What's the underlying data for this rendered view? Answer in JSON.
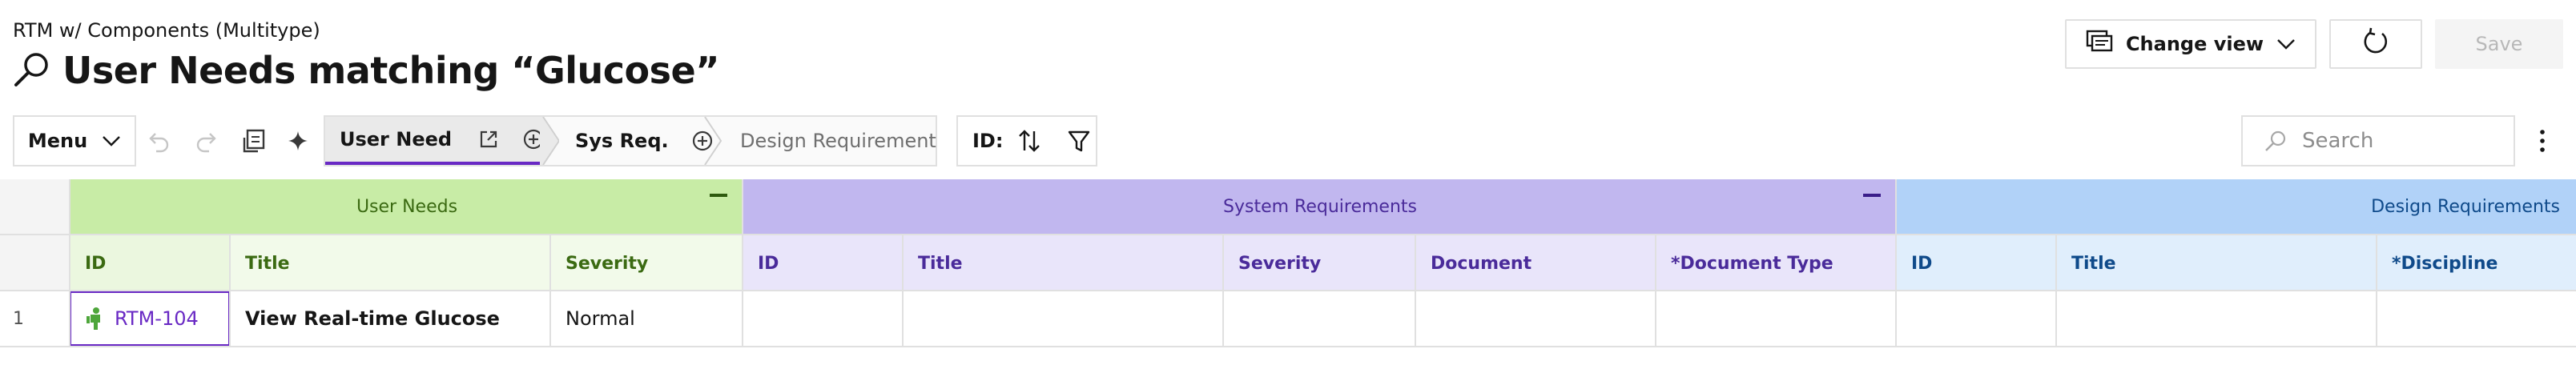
{
  "header": {
    "subtitle": "RTM w/ Components (Multitype)",
    "title": "User Needs matching “Glucose”",
    "change_view_label": "Change view",
    "save_label": "Save"
  },
  "toolbar": {
    "menu_label": "Menu",
    "breadcrumbs": [
      {
        "label": "User Need",
        "active": true
      },
      {
        "label": "Sys Req.",
        "active": false
      },
      {
        "label": "Design Requirement",
        "active": false
      }
    ],
    "sort_label": "ID:",
    "search_placeholder": "Search"
  },
  "colors": {
    "accent": "#6929c4",
    "user_needs_group": "#c8eca6",
    "user_needs_col": "#ebf7df",
    "system_req_group": "#c1b7ef",
    "system_req_col": "#e9e5fa",
    "design_req_group": "#b1d2f8",
    "design_req_col": "#e0eefc",
    "user_need_icon": "#4ea63b"
  },
  "grid": {
    "groups": [
      {
        "label": "User Needs"
      },
      {
        "label": "System Requirements"
      },
      {
        "label": "Design Requirements"
      }
    ],
    "columns": {
      "user_needs": [
        "ID",
        "Title",
        "Severity"
      ],
      "system_requirements": [
        "ID",
        "Title",
        "Severity",
        "Document",
        "*Document Type"
      ],
      "design_requirements": [
        "ID",
        "Title",
        "*Discipline"
      ]
    },
    "rows": [
      {
        "num": "1",
        "id": "RTM-104",
        "title": "View Real-time Glucose",
        "severity": "Normal",
        "icon": "user-need-person-icon"
      }
    ]
  }
}
